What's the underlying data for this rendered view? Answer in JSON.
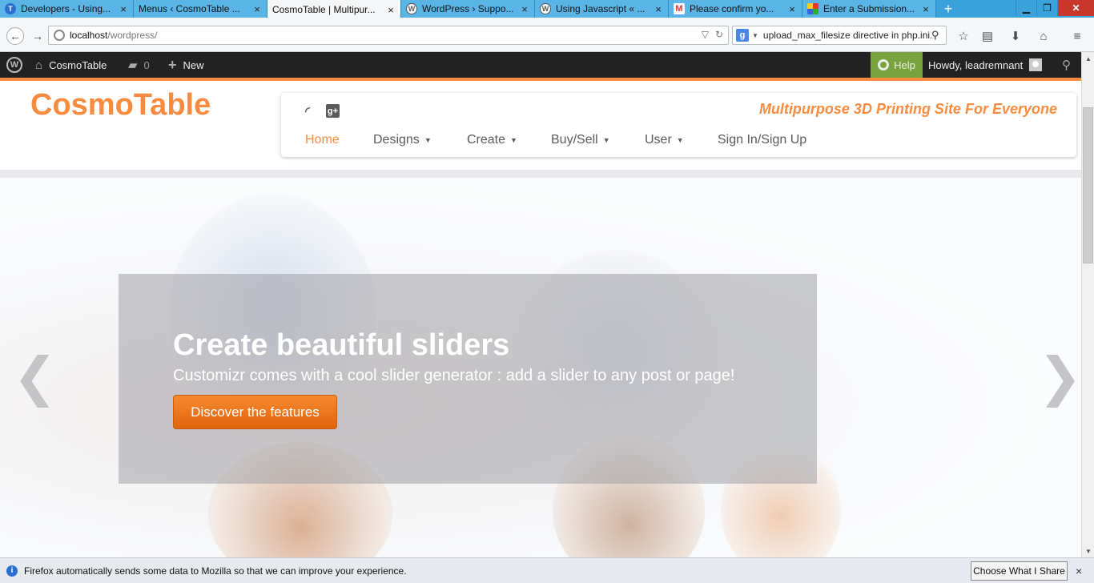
{
  "browser": {
    "tabs": [
      {
        "title": "Developers - Using...",
        "icon": "circle-t-icon",
        "color": "#2b6ecf"
      },
      {
        "title": "Menus ‹ CosmoTable ...",
        "icon": "none",
        "color": ""
      },
      {
        "title": "CosmoTable | Multipur...",
        "icon": "none",
        "color": "",
        "active": true
      },
      {
        "title": "WordPress › Suppo...",
        "icon": "wordpress-icon",
        "color": "#555"
      },
      {
        "title": "Using Javascript « ...",
        "icon": "wordpress-icon",
        "color": "#555"
      },
      {
        "title": "Please confirm yo...",
        "icon": "gmail-icon",
        "color": "#d33"
      },
      {
        "title": "Enter a Submission...",
        "icon": "pinwheel-icon",
        "color": "#e8a21a"
      }
    ],
    "new_tab": "+",
    "url_host": "localhost",
    "url_path": "/wordpress/",
    "search_engine_badge": "g",
    "search_text": "upload_max_filesize directive in php.ini."
  },
  "adminbar": {
    "site_name": "CosmoTable",
    "comments_count": "0",
    "new_label": "New",
    "help_label": "Help",
    "howdy": "Howdy, leadremnant"
  },
  "site": {
    "brand": "CosmoTable",
    "tagline": "Multipurpose 3D Printing Site For Everyone",
    "menu": [
      {
        "label": "Home",
        "dropdown": false,
        "active": true
      },
      {
        "label": "Designs",
        "dropdown": true
      },
      {
        "label": "Create",
        "dropdown": true
      },
      {
        "label": "Buy/Sell",
        "dropdown": true
      },
      {
        "label": "User",
        "dropdown": true
      },
      {
        "label": "Sign In/Sign Up",
        "dropdown": false
      }
    ]
  },
  "slider": {
    "title": "Create beautiful sliders",
    "subtitle": "Customizr comes with a cool slider generator : add a slider to any post or page!",
    "button": "Discover the features",
    "prev_arrow": "❮",
    "next_arrow": "❯"
  },
  "notification": {
    "text": "Firefox automatically sends some data to Mozilla so that we can improve your experience.",
    "button": "Choose What I Share",
    "close": "×"
  },
  "colors": {
    "accent": "#f78c40",
    "adminbar": "#222222",
    "help": "#79a33f",
    "tabstrip": "#3aa3dc"
  }
}
